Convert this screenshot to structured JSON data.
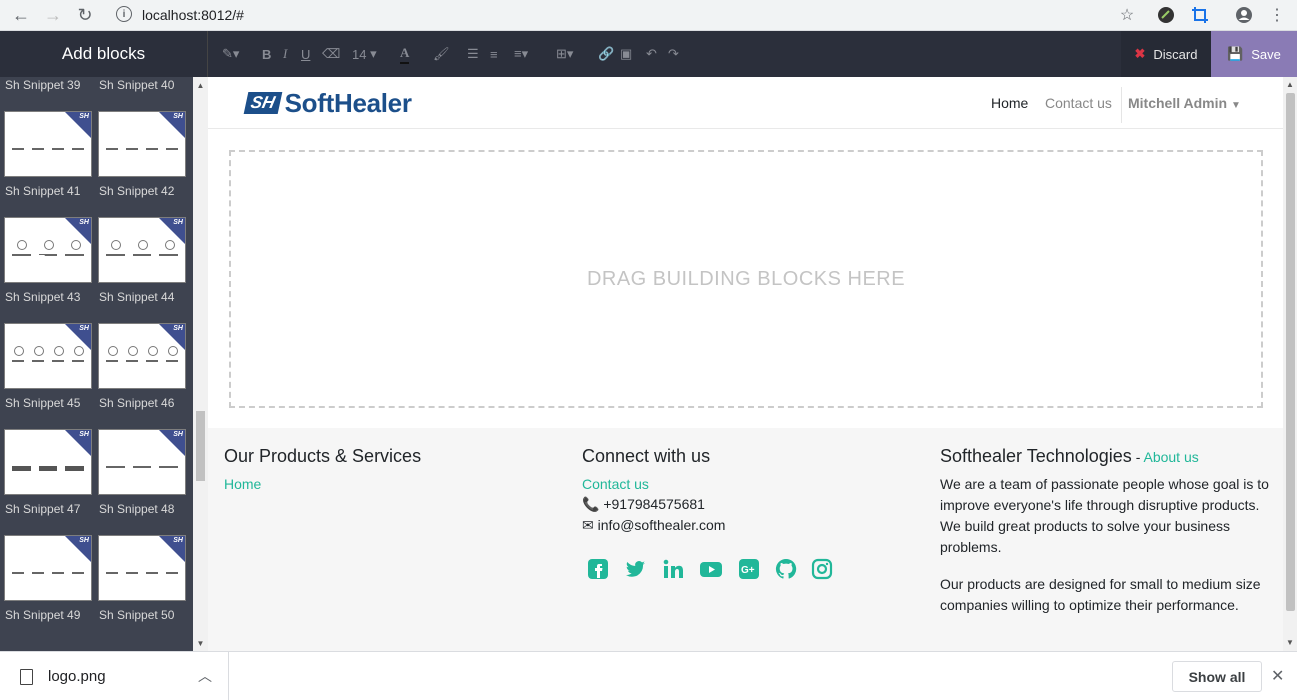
{
  "browser": {
    "url": "localhost:8012/#",
    "back_icon": "←",
    "forward_icon": "→",
    "reload_icon": "↻",
    "info_icon": "i",
    "star_icon": "☆",
    "menu_icon": "⋮"
  },
  "toolbar": {
    "add_blocks": "Add blocks",
    "font_size": "14",
    "discard": "Discard",
    "save": "Save"
  },
  "snippets": [
    {
      "label": "Sh Snippet 39"
    },
    {
      "label": "Sh Snippet 40"
    },
    {
      "label": "Sh Snippet 41"
    },
    {
      "label": "Sh Snippet 42"
    },
    {
      "label": "Sh Snippet 43"
    },
    {
      "label": "Sh Snippet 44"
    },
    {
      "label": "Sh Snippet 45"
    },
    {
      "label": "Sh Snippet 46"
    },
    {
      "label": "Sh Snippet 47"
    },
    {
      "label": "Sh Snippet 48"
    },
    {
      "label": "Sh Snippet 49"
    },
    {
      "label": "Sh Snippet 50"
    }
  ],
  "snippet_badge": "SH",
  "site": {
    "logo_mark": "SH",
    "logo_text": "SoftHealer",
    "nav": {
      "home": "Home",
      "contact": "Contact us",
      "user": "Mitchell Admin"
    },
    "dropzone": "DRAG BUILDING BLOCKS HERE"
  },
  "footer": {
    "products_title": "Our Products & Services",
    "products_link": "Home",
    "connect_title": "Connect with us",
    "connect_link": "Contact us",
    "phone": "+917984575681",
    "email": "info@softhealer.com",
    "company_title": "Softhealer Technologies",
    "company_sep": " - ",
    "about_link": "About us",
    "about_p1": "We are a team of passionate people whose goal is to improve everyone's life through disruptive products. We build great products to solve your business problems.",
    "about_p2": "Our products are designed for small to medium size companies willing to optimize their performance."
  },
  "downloads": {
    "file_name": "logo.png",
    "show_all": "Show all"
  },
  "colors": {
    "accent": "#21b799",
    "editor_bar": "#2b2f3b",
    "save_button": "#8a7bb5"
  }
}
